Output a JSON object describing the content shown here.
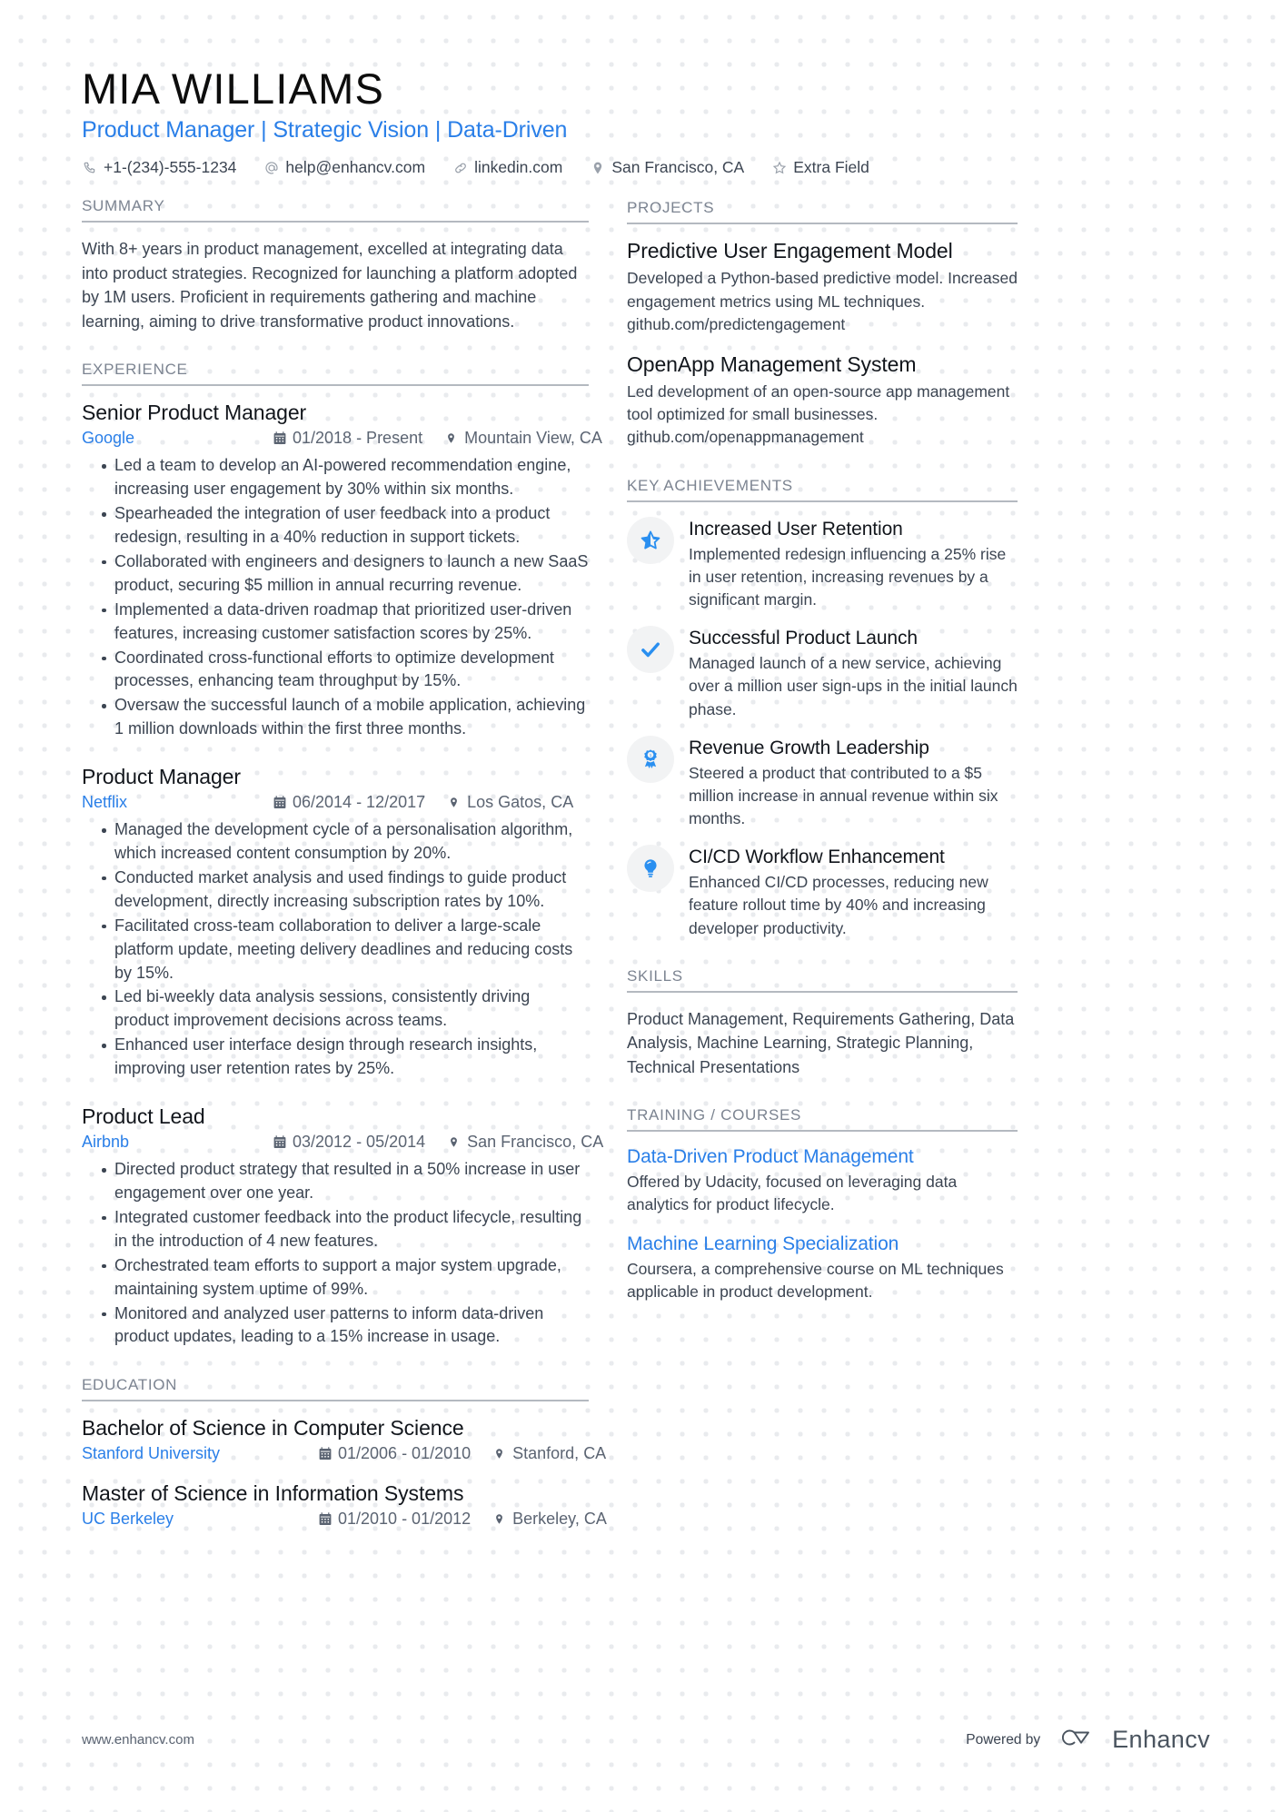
{
  "header": {
    "name": "MIA WILLIAMS",
    "headline": "Product Manager | Strategic Vision | Data-Driven",
    "contacts": [
      {
        "icon": "phone-icon",
        "text": "+1-(234)-555-1234"
      },
      {
        "icon": "email-icon",
        "text": "help@enhancv.com"
      },
      {
        "icon": "link-icon",
        "text": "linkedin.com"
      },
      {
        "icon": "location-pin-icon",
        "text": "San Francisco, CA"
      },
      {
        "icon": "star-icon",
        "text": "Extra Field"
      }
    ]
  },
  "summary": {
    "heading": "SUMMARY",
    "text": "With 8+ years in product management, excelled at integrating data into product strategies. Recognized for launching a platform adopted by 1M users. Proficient in requirements gathering and machine learning, aiming to drive transformative product innovations."
  },
  "experience": {
    "heading": "EXPERIENCE",
    "entries": [
      {
        "title": "Senior Product Manager",
        "org": "Google",
        "dates": "01/2018 - Present",
        "location": "Mountain View, CA",
        "bullets": [
          "Led a team to develop an AI-powered recommendation engine, increasing user engagement by 30% within six months.",
          "Spearheaded the integration of user feedback into a product redesign, resulting in a 40% reduction in support tickets.",
          "Collaborated with engineers and designers to launch a new SaaS product, securing $5 million in annual recurring revenue.",
          "Implemented a data-driven roadmap that prioritized user-driven features, increasing customer satisfaction scores by 25%.",
          "Coordinated cross-functional efforts to optimize development processes, enhancing team throughput by 15%.",
          "Oversaw the successful launch of a mobile application, achieving 1 million downloads within the first three months."
        ]
      },
      {
        "title": "Product Manager",
        "org": "Netflix",
        "dates": "06/2014 - 12/2017",
        "location": "Los Gatos, CA",
        "bullets": [
          "Managed the development cycle of a personalisation algorithm, which increased content consumption by 20%.",
          "Conducted market analysis and used findings to guide product development, directly increasing subscription rates by 10%.",
          "Facilitated cross-team collaboration to deliver a large-scale platform update, meeting delivery deadlines and reducing costs by 15%.",
          "Led bi-weekly data analysis sessions, consistently driving product improvement decisions across teams.",
          "Enhanced user interface design through research insights, improving user retention rates by 25%."
        ]
      },
      {
        "title": "Product Lead",
        "org": "Airbnb",
        "dates": "03/2012 - 05/2014",
        "location": "San Francisco, CA",
        "bullets": [
          "Directed product strategy that resulted in a 50% increase in user engagement over one year.",
          "Integrated customer feedback into the product lifecycle, resulting in the introduction of 4 new features.",
          "Orchestrated team efforts to support a major system upgrade, maintaining system uptime of 99%.",
          "Monitored and analyzed user patterns to inform data-driven product updates, leading to a 15% increase in usage."
        ]
      }
    ]
  },
  "education": {
    "heading": "EDUCATION",
    "entries": [
      {
        "title": "Bachelor of Science in Computer Science",
        "org": "Stanford University",
        "dates": "01/2006 - 01/2010",
        "location": "Stanford, CA"
      },
      {
        "title": "Master of Science in Information Systems",
        "org": "UC Berkeley",
        "dates": "01/2010 - 01/2012",
        "location": "Berkeley, CA"
      }
    ]
  },
  "projects": {
    "heading": "PROJECTS",
    "items": [
      {
        "title": "Predictive User Engagement Model",
        "description": "Developed a Python-based predictive model. Increased engagement metrics using ML techniques. github.com/predictengagement"
      },
      {
        "title": "OpenApp Management System",
        "description": "Led development of an open-source app management tool optimized for small businesses. github.com/openappmanagement"
      }
    ]
  },
  "key_achievements": {
    "heading": "KEY ACHIEVEMENTS",
    "items": [
      {
        "icon": "star-badge-icon",
        "title": "Increased User Retention",
        "description": "Implemented redesign influencing a 25% rise in user retention, increasing revenues by a significant margin."
      },
      {
        "icon": "checkmark-icon",
        "title": "Successful Product Launch",
        "description": "Managed launch of a new service, achieving over a million user sign-ups in the initial launch phase."
      },
      {
        "icon": "award-ribbon-icon",
        "title": "Revenue Growth Leadership",
        "description": "Steered a product that contributed to a $5 million increase in annual revenue within six months."
      },
      {
        "icon": "lightbulb-icon",
        "title": "CI/CD Workflow Enhancement",
        "description": "Enhanced CI/CD processes, reducing new feature rollout time by 40% and increasing developer productivity."
      }
    ]
  },
  "skills": {
    "heading": "SKILLS",
    "text": "Product Management, Requirements Gathering, Data Analysis, Machine Learning, Strategic Planning, Technical Presentations"
  },
  "training": {
    "heading": "TRAINING / COURSES",
    "items": [
      {
        "title": "Data-Driven Product Management",
        "description": "Offered by Udacity, focused on leveraging data analytics for product lifecycle."
      },
      {
        "title": "Machine Learning Specialization",
        "description": "Coursera, a comprehensive course on ML techniques applicable in product development."
      }
    ]
  },
  "footer": {
    "url": "www.enhancv.com",
    "powered_by": "Powered by",
    "brand": "Enhancv"
  },
  "colors": {
    "accent": "#2a7fe8",
    "icon_accent": "#2a8ff0",
    "text": "#3c4552",
    "heading": "#12161c",
    "muted": "#7c8491",
    "rule": "#b4b9c0",
    "icon_bg": "#f2f3f4"
  }
}
